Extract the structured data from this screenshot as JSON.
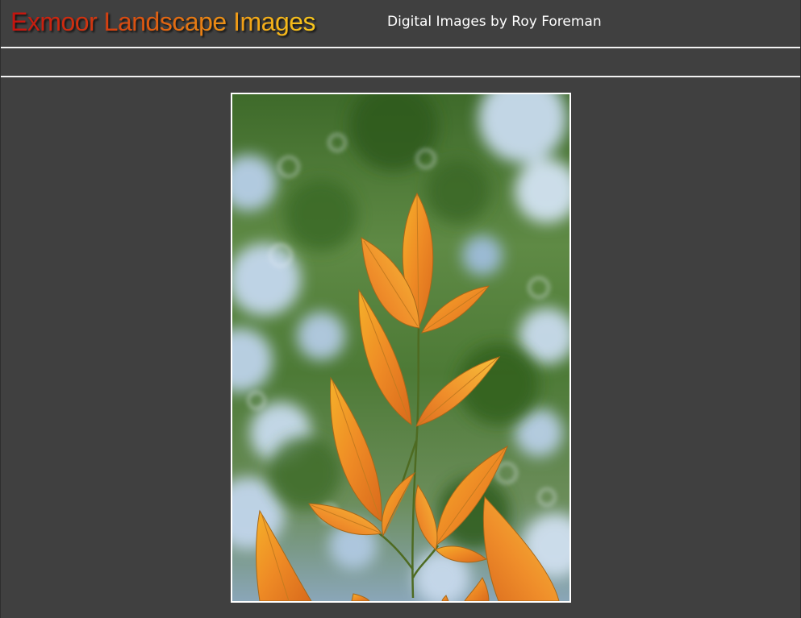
{
  "header": {
    "site_title": "Exmoor Landscape Images",
    "site_subtitle": "Digital Images by Roy Foreman"
  },
  "photo": {
    "subject": "orange-leaves-photo"
  }
}
